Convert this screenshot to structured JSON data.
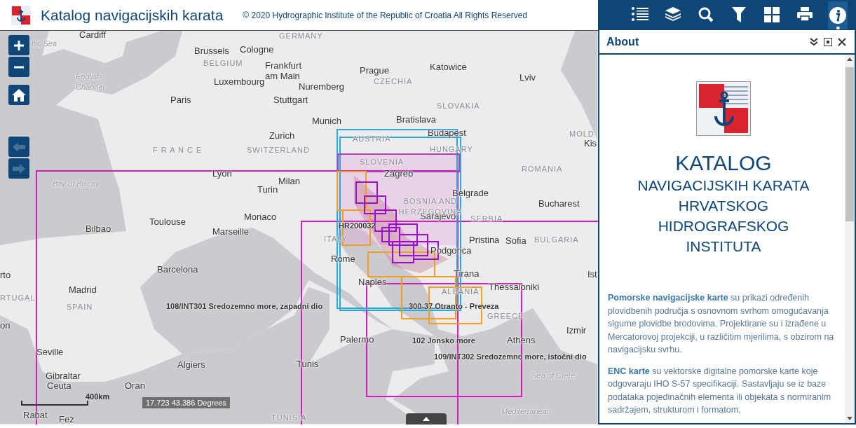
{
  "header": {
    "title": "Katalog navigacijskih karata",
    "copyright": "© 2020 Hydrographic Institute of the Republic of Croatia All Rights Reserved"
  },
  "toolbar": [
    {
      "kind": "list",
      "selected": false
    },
    {
      "kind": "layers",
      "selected": false
    },
    {
      "kind": "search",
      "selected": false
    },
    {
      "kind": "filter",
      "selected": false
    },
    {
      "kind": "grid",
      "selected": false
    },
    {
      "kind": "print",
      "selected": false
    },
    {
      "kind": "info",
      "selected": true
    }
  ],
  "map": {
    "nav": [
      {
        "kind": "back",
        "disabled": true
      },
      {
        "kind": "forward",
        "disabled": true
      }
    ],
    "labels": [
      {
        "text": "Cardiff",
        "kind": "city"
      },
      {
        "text": "Brussels",
        "kind": "city"
      },
      {
        "text": "Cologne",
        "kind": "city"
      },
      {
        "text": "Frankfurt am Main",
        "kind": "city"
      },
      {
        "text": "Prague",
        "kind": "city"
      },
      {
        "text": "Katowice",
        "kind": "city"
      },
      {
        "text": "Luxembourg",
        "kind": "city"
      },
      {
        "text": "Nuremberg",
        "kind": "city"
      },
      {
        "text": "Lviv",
        "kind": "city"
      },
      {
        "text": "Paris",
        "kind": "city"
      },
      {
        "text": "Stuttgart",
        "kind": "city"
      },
      {
        "text": "Munich",
        "kind": "city"
      },
      {
        "text": "Bratislava",
        "kind": "city"
      },
      {
        "text": "Zurich",
        "kind": "city"
      },
      {
        "text": "Budapest",
        "kind": "city"
      },
      {
        "text": "Lyon",
        "kind": "city"
      },
      {
        "text": "Milan",
        "kind": "city"
      },
      {
        "text": "Zagreb",
        "kind": "city"
      },
      {
        "text": "Turin",
        "kind": "city"
      },
      {
        "text": "Belgrade",
        "kind": "city"
      },
      {
        "text": "Bucharest",
        "kind": "city"
      },
      {
        "text": "Monaco",
        "kind": "city"
      },
      {
        "text": "Marseille",
        "kind": "city"
      },
      {
        "text": "Toulouse",
        "kind": "city"
      },
      {
        "text": "Bilbao",
        "kind": "city"
      },
      {
        "text": "Sarajevo",
        "kind": "city"
      },
      {
        "text": "Pristina",
        "kind": "city"
      },
      {
        "text": "Sofia",
        "kind": "city"
      },
      {
        "text": "Podgorica",
        "kind": "city"
      },
      {
        "text": "Rome",
        "kind": "city"
      },
      {
        "text": "Barcelona",
        "kind": "city"
      },
      {
        "text": "Madrid",
        "kind": "city"
      },
      {
        "text": "Naples",
        "kind": "city"
      },
      {
        "text": "Tirana",
        "kind": "city"
      },
      {
        "text": "Thessaloniki",
        "kind": "city"
      },
      {
        "text": "Izmir",
        "kind": "city"
      },
      {
        "text": "Palermo",
        "kind": "city"
      },
      {
        "text": "Athens",
        "kind": "city"
      },
      {
        "text": "Seville",
        "kind": "city"
      },
      {
        "text": "Algiers",
        "kind": "city"
      },
      {
        "text": "Tunis",
        "kind": "city"
      },
      {
        "text": "Gibraltar",
        "kind": "city"
      },
      {
        "text": "Ceuta",
        "kind": "city"
      },
      {
        "text": "Oran",
        "kind": "city"
      },
      {
        "text": "Rabat",
        "kind": "city"
      },
      {
        "text": "Fez",
        "kind": "city"
      },
      {
        "text": "rto",
        "kind": "city"
      },
      {
        "text": "on",
        "kind": "city"
      },
      {
        "text": "Kis",
        "kind": "city"
      },
      {
        "text": "Ist",
        "kind": "city"
      },
      {
        "text": "GERMANY",
        "kind": "country"
      },
      {
        "text": "BELGIUM",
        "kind": "country"
      },
      {
        "text": "CZECHIA",
        "kind": "country"
      },
      {
        "text": "SLOVAKIA",
        "kind": "country"
      },
      {
        "text": "AUSTRIA",
        "kind": "country"
      },
      {
        "text": "HUNGARY",
        "kind": "country"
      },
      {
        "text": "MOLD",
        "kind": "country"
      },
      {
        "text": "F R A N C E",
        "kind": "country"
      },
      {
        "text": "SWITZERLAND",
        "kind": "country"
      },
      {
        "text": "ROMANIA",
        "kind": "country"
      },
      {
        "text": "SLOVENIA",
        "kind": "country"
      },
      {
        "text": "BOSNIA AND HERZEGOVINA",
        "kind": "country"
      },
      {
        "text": "SERBIA",
        "kind": "country"
      },
      {
        "text": "ITALY",
        "kind": "country"
      },
      {
        "text": "BULGARIA",
        "kind": "country"
      },
      {
        "text": "RTUGAL",
        "kind": "country"
      },
      {
        "text": "SPAIN",
        "kind": "country"
      },
      {
        "text": "ALBANIA",
        "kind": "country"
      },
      {
        "text": "GREECE",
        "kind": "country"
      },
      {
        "text": "TUNISIA",
        "kind": "country"
      },
      {
        "text": "ltic Sea",
        "kind": "sea"
      },
      {
        "text": "English Channel",
        "kind": "sea"
      },
      {
        "text": "Bay of Biscay",
        "kind": "sea"
      },
      {
        "text": "Sea of Crete",
        "kind": "sea"
      },
      {
        "text": "Mediterranean",
        "kind": "sea"
      }
    ],
    "chart_labels": [
      "HR200032",
      "108/INT301 Sredozemno more, zapadni dio",
      "300-37 Otranto - Preveza",
      "102 Jonsko more",
      "109/INT302 Sredozemno more, istočni dio"
    ],
    "scale": "400km",
    "coordinates": "17.723 43.386 Degrees"
  },
  "panel": {
    "title": "About",
    "heading": "KATALOG",
    "subheading": [
      "NAVIGACIJSKIH KARATA",
      "HRVATSKOG",
      "HIDROGRAFSKOG",
      "INSTITUTA"
    ],
    "paragraphs": [
      "**Pomorske navigacijske karte** su prikazi određenih plovidbenih područja s osnovnom svrhom omogućavanja sigurne plovidbe brodovima. Projektirane su i izrađene u Mercatorovoj projekciji, u različitim mjerilima, s obzirom na navigacijsku svrhu.",
      "**ENC karte** su vektorske digitalne pomorske karte koje odgovaraju IHO S-57 specifikaciji. Sastavljaju se iz baze podataka pojedinačnih elementa ili objekata s normiranim sadržajem, strukturom i formatom,"
    ]
  }
}
